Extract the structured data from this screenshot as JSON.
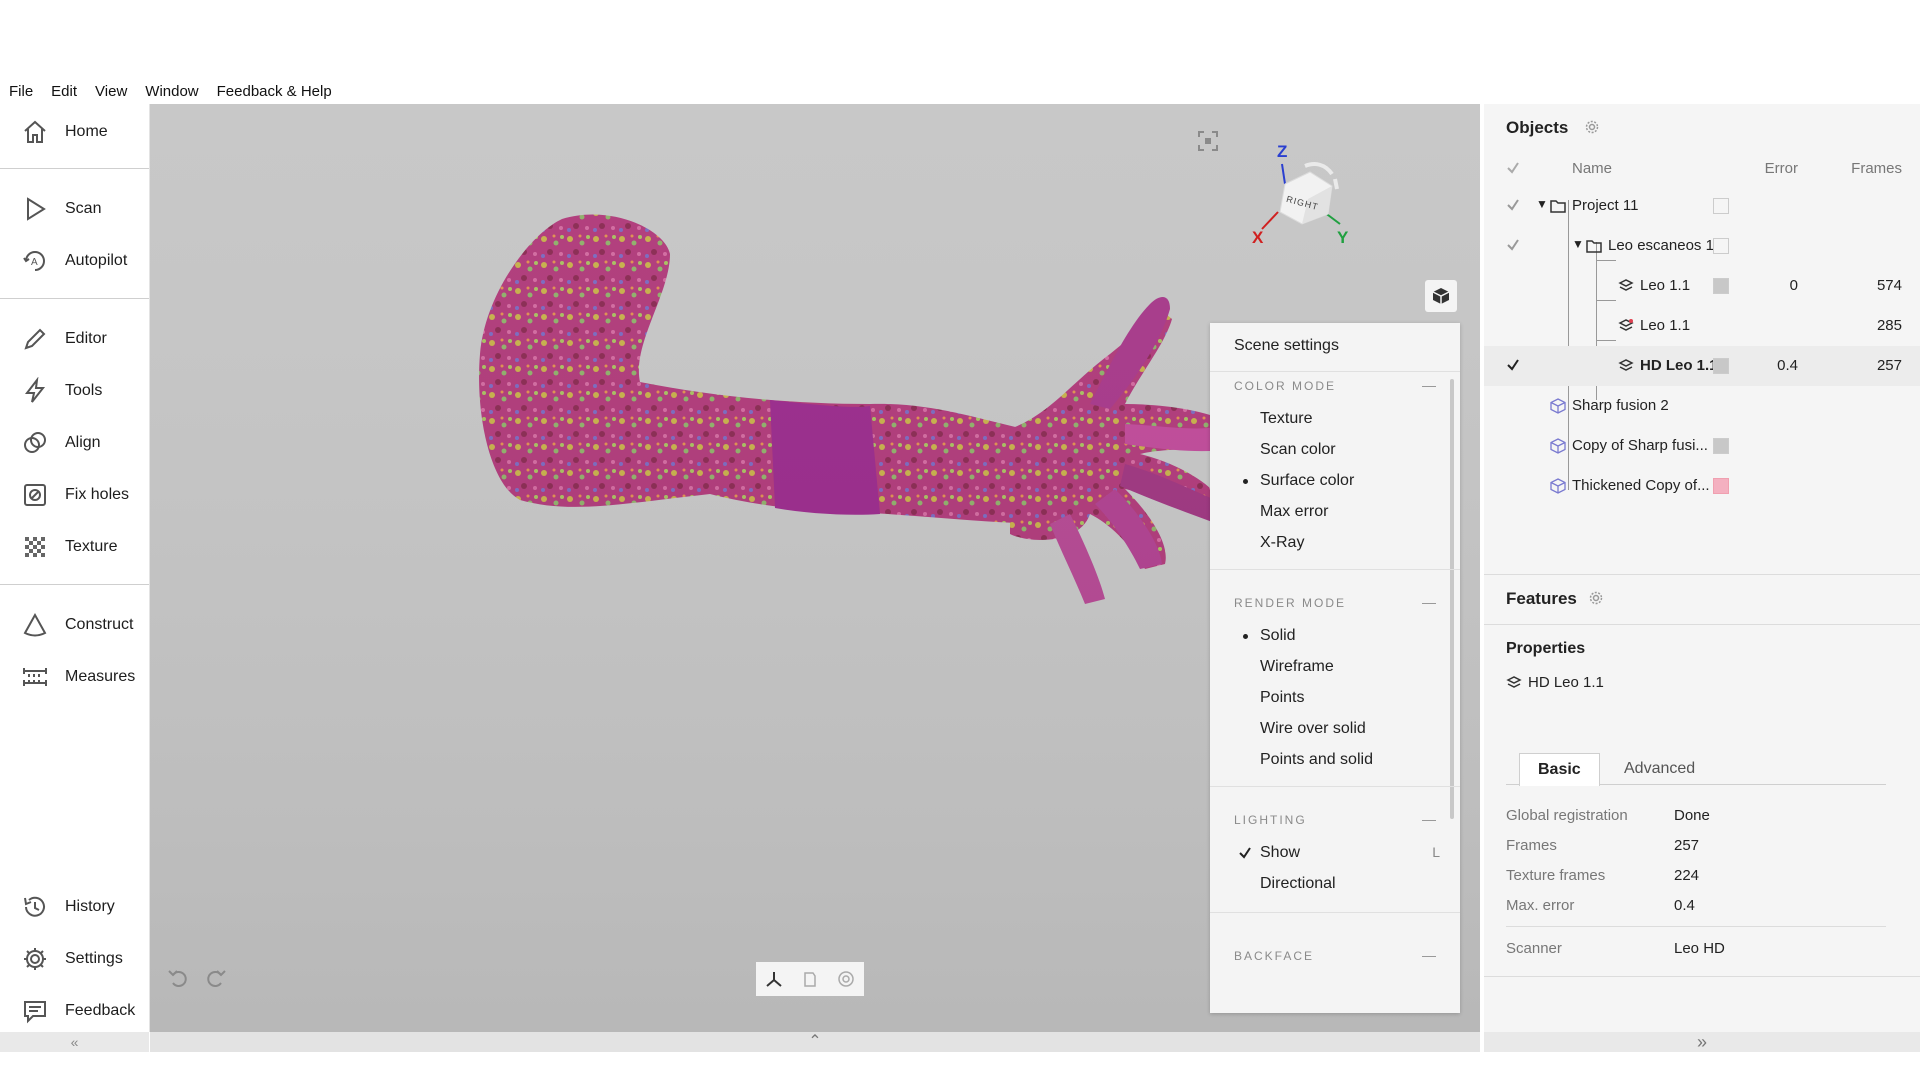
{
  "menu": [
    "File",
    "Edit",
    "View",
    "Window",
    "Feedback & Help"
  ],
  "sidebar": {
    "items": [
      {
        "label": "Home",
        "icon": "home-icon"
      },
      {
        "label": "Scan",
        "icon": "play-icon"
      },
      {
        "label": "Autopilot",
        "icon": "autopilot-icon"
      },
      {
        "label": "Editor",
        "icon": "pencil-icon"
      },
      {
        "label": "Tools",
        "icon": "lightning-icon"
      },
      {
        "label": "Align",
        "icon": "align-icon"
      },
      {
        "label": "Fix holes",
        "icon": "fix-holes-icon"
      },
      {
        "label": "Texture",
        "icon": "checker-icon"
      },
      {
        "label": "Construct",
        "icon": "cone-icon"
      },
      {
        "label": "Measures",
        "icon": "ruler-icon"
      },
      {
        "label": "History",
        "icon": "history-icon"
      },
      {
        "label": "Settings",
        "icon": "gear-icon"
      },
      {
        "label": "Feedback",
        "icon": "chat-icon"
      }
    ],
    "collapse": "«"
  },
  "viewport": {
    "background": "#c6c6c6",
    "gizmo": {
      "z": "Z",
      "x": "X",
      "y": "Y",
      "cube_face": "RIGHT"
    },
    "expand": "⌃"
  },
  "scene_settings": {
    "title": "Scene settings",
    "color_mode": {
      "heading": "COLOR MODE",
      "options": [
        "Texture",
        "Scan color",
        "Surface color",
        "Max error",
        "X-Ray"
      ],
      "selected": "Surface color"
    },
    "render_mode": {
      "heading": "RENDER MODE",
      "options": [
        "Solid",
        "Wireframe",
        "Points",
        "Wire over solid",
        "Points and solid"
      ],
      "selected": "Solid"
    },
    "lighting": {
      "heading": "LIGHTING",
      "show": "Show",
      "show_shortcut": "L",
      "directional": "Directional"
    },
    "backface": {
      "heading": "BACKFACE"
    }
  },
  "objects": {
    "title": "Objects",
    "columns": {
      "name": "Name",
      "error": "Error",
      "frames": "Frames"
    },
    "rows": [
      {
        "name": "Project 11",
        "error": "",
        "frames": ""
      },
      {
        "name": "Leo escaneos 1",
        "error": "",
        "frames": ""
      },
      {
        "name": "Leo 1.1",
        "error": "0",
        "frames": "574"
      },
      {
        "name": "Leo 1.1",
        "error": "",
        "frames": "285"
      },
      {
        "name": "HD Leo 1.1",
        "error": "0.4",
        "frames": "257"
      },
      {
        "name": "Sharp fusion 2",
        "error": "",
        "frames": ""
      },
      {
        "name": "Copy of Sharp fusi...",
        "error": "",
        "frames": ""
      },
      {
        "name": "Thickened Copy of...",
        "error": "",
        "frames": ""
      }
    ]
  },
  "features": {
    "title": "Features"
  },
  "properties": {
    "title": "Properties",
    "object": "HD Leo 1.1",
    "tabs": [
      "Basic",
      "Advanced"
    ],
    "fields": [
      {
        "key": "Global registration",
        "value": "Done"
      },
      {
        "key": "Frames",
        "value": "257"
      },
      {
        "key": "Texture frames",
        "value": "224"
      },
      {
        "key": "Max. error",
        "value": "0.4"
      },
      {
        "key": "Scanner",
        "value": "Leo HD"
      }
    ]
  },
  "right_bottom": "»"
}
